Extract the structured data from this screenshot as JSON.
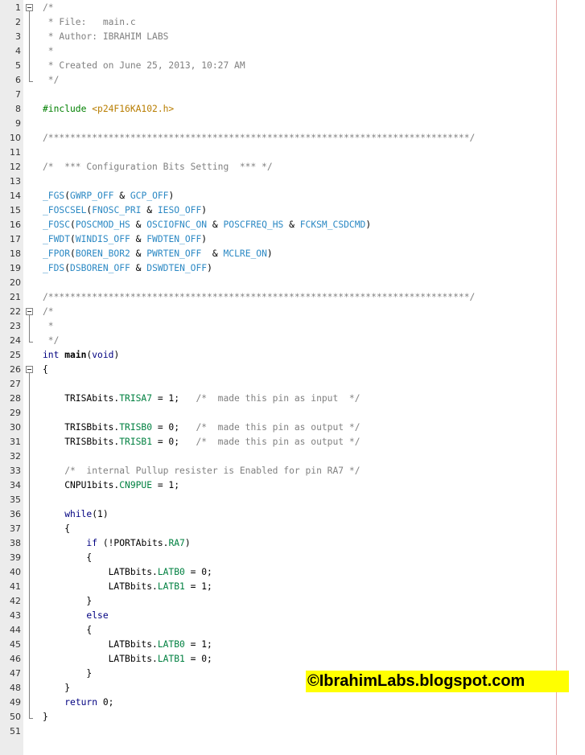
{
  "editor": {
    "lines": [
      {
        "n": "1",
        "tokens": [
          {
            "t": "/*",
            "c": "comment"
          }
        ]
      },
      {
        "n": "2",
        "tokens": [
          {
            "t": " * File:   main.c",
            "c": "comment"
          }
        ]
      },
      {
        "n": "3",
        "tokens": [
          {
            "t": " * Author: IBRAHIM LABS",
            "c": "comment"
          }
        ]
      },
      {
        "n": "4",
        "tokens": [
          {
            "t": " *",
            "c": "comment"
          }
        ]
      },
      {
        "n": "5",
        "tokens": [
          {
            "t": " * Created on June 25, 2013, 10:27 AM",
            "c": "comment"
          }
        ]
      },
      {
        "n": "6",
        "tokens": [
          {
            "t": " */",
            "c": "comment"
          }
        ]
      },
      {
        "n": "7",
        "tokens": []
      },
      {
        "n": "8",
        "tokens": [
          {
            "t": "#include ",
            "c": "pre"
          },
          {
            "t": "<p24F16KA102.h>",
            "c": "str"
          }
        ]
      },
      {
        "n": "9",
        "tokens": []
      },
      {
        "n": "10",
        "tokens": [
          {
            "t": "/*****************************************************************************/",
            "c": "comment"
          }
        ]
      },
      {
        "n": "11",
        "tokens": []
      },
      {
        "n": "12",
        "tokens": [
          {
            "t": "/*  *** Configuration Bits Setting  *** */",
            "c": "comment"
          }
        ]
      },
      {
        "n": "13",
        "tokens": []
      },
      {
        "n": "14",
        "tokens": [
          {
            "t": "_FGS",
            "c": "mac"
          },
          {
            "t": "(",
            "c": ""
          },
          {
            "t": "GWRP_OFF",
            "c": "mac"
          },
          {
            "t": " & ",
            "c": ""
          },
          {
            "t": "GCP_OFF",
            "c": "mac"
          },
          {
            "t": ")",
            "c": ""
          }
        ]
      },
      {
        "n": "15",
        "tokens": [
          {
            "t": "_FOSCSEL",
            "c": "mac"
          },
          {
            "t": "(",
            "c": ""
          },
          {
            "t": "FNOSC_PRI",
            "c": "mac"
          },
          {
            "t": " & ",
            "c": ""
          },
          {
            "t": "IESO_OFF",
            "c": "mac"
          },
          {
            "t": ")",
            "c": ""
          }
        ]
      },
      {
        "n": "16",
        "tokens": [
          {
            "t": "_FOSC",
            "c": "mac"
          },
          {
            "t": "(",
            "c": ""
          },
          {
            "t": "POSCMOD_HS",
            "c": "mac"
          },
          {
            "t": " & ",
            "c": ""
          },
          {
            "t": "OSCIOFNC_ON",
            "c": "mac"
          },
          {
            "t": " & ",
            "c": ""
          },
          {
            "t": "POSCFREQ_HS",
            "c": "mac"
          },
          {
            "t": " & ",
            "c": ""
          },
          {
            "t": "FCKSM_CSDCMD",
            "c": "mac"
          },
          {
            "t": ")",
            "c": ""
          }
        ]
      },
      {
        "n": "17",
        "tokens": [
          {
            "t": "_FWDT",
            "c": "mac"
          },
          {
            "t": "(",
            "c": ""
          },
          {
            "t": "WINDIS_OFF",
            "c": "mac"
          },
          {
            "t": " & ",
            "c": ""
          },
          {
            "t": "FWDTEN_OFF",
            "c": "mac"
          },
          {
            "t": ")",
            "c": ""
          }
        ]
      },
      {
        "n": "18",
        "tokens": [
          {
            "t": "_FPOR",
            "c": "mac"
          },
          {
            "t": "(",
            "c": ""
          },
          {
            "t": "BOREN_BOR2",
            "c": "mac"
          },
          {
            "t": " & ",
            "c": ""
          },
          {
            "t": "PWRTEN_OFF",
            "c": "mac"
          },
          {
            "t": "  & ",
            "c": ""
          },
          {
            "t": "MCLRE_ON",
            "c": "mac"
          },
          {
            "t": ")",
            "c": ""
          }
        ]
      },
      {
        "n": "19",
        "tokens": [
          {
            "t": "_FDS",
            "c": "mac"
          },
          {
            "t": "(",
            "c": ""
          },
          {
            "t": "DSBOREN_OFF",
            "c": "mac"
          },
          {
            "t": " & ",
            "c": ""
          },
          {
            "t": "DSWDTEN_OFF",
            "c": "mac"
          },
          {
            "t": ")",
            "c": ""
          }
        ]
      },
      {
        "n": "20",
        "tokens": []
      },
      {
        "n": "21",
        "tokens": [
          {
            "t": "/*****************************************************************************/",
            "c": "comment"
          }
        ]
      },
      {
        "n": "22",
        "tokens": [
          {
            "t": "/*",
            "c": "comment"
          }
        ]
      },
      {
        "n": "23",
        "tokens": [
          {
            "t": " *",
            "c": "comment"
          }
        ]
      },
      {
        "n": "24",
        "tokens": [
          {
            "t": " */",
            "c": "comment"
          }
        ]
      },
      {
        "n": "25",
        "tokens": [
          {
            "t": "int",
            "c": "kw"
          },
          {
            "t": " ",
            "c": ""
          },
          {
            "t": "main",
            "c": "bold"
          },
          {
            "t": "(",
            "c": ""
          },
          {
            "t": "void",
            "c": "kw"
          },
          {
            "t": ")",
            "c": ""
          }
        ]
      },
      {
        "n": "26",
        "tokens": [
          {
            "t": "{",
            "c": ""
          }
        ]
      },
      {
        "n": "27",
        "tokens": []
      },
      {
        "n": "28",
        "tokens": [
          {
            "t": "    TRISAbits.",
            "c": ""
          },
          {
            "t": "TRISA7",
            "c": "fld"
          },
          {
            "t": " = 1;   ",
            "c": ""
          },
          {
            "t": "/*  made this pin as input  */",
            "c": "comment"
          }
        ]
      },
      {
        "n": "29",
        "tokens": []
      },
      {
        "n": "30",
        "tokens": [
          {
            "t": "    TRISBbits.",
            "c": ""
          },
          {
            "t": "TRISB0",
            "c": "fld"
          },
          {
            "t": " = 0;   ",
            "c": ""
          },
          {
            "t": "/*  made this pin as output */",
            "c": "comment"
          }
        ]
      },
      {
        "n": "31",
        "tokens": [
          {
            "t": "    TRISBbits.",
            "c": ""
          },
          {
            "t": "TRISB1",
            "c": "fld"
          },
          {
            "t": " = 0;   ",
            "c": ""
          },
          {
            "t": "/*  made this pin as output */",
            "c": "comment"
          }
        ]
      },
      {
        "n": "32",
        "tokens": []
      },
      {
        "n": "33",
        "tokens": [
          {
            "t": "    ",
            "c": ""
          },
          {
            "t": "/*  internal Pullup resister is Enabled for pin RA7 */",
            "c": "comment"
          }
        ]
      },
      {
        "n": "34",
        "tokens": [
          {
            "t": "    CNPU1bits.",
            "c": ""
          },
          {
            "t": "CN9PUE",
            "c": "fld"
          },
          {
            "t": " = 1;",
            "c": ""
          }
        ]
      },
      {
        "n": "35",
        "tokens": []
      },
      {
        "n": "36",
        "tokens": [
          {
            "t": "    ",
            "c": ""
          },
          {
            "t": "while",
            "c": "kw"
          },
          {
            "t": "(1)",
            "c": ""
          }
        ]
      },
      {
        "n": "37",
        "tokens": [
          {
            "t": "    {",
            "c": ""
          }
        ]
      },
      {
        "n": "38",
        "tokens": [
          {
            "t": "        ",
            "c": ""
          },
          {
            "t": "if",
            "c": "kw"
          },
          {
            "t": " (!PORTAbits.",
            "c": ""
          },
          {
            "t": "RA7",
            "c": "fld"
          },
          {
            "t": ")",
            "c": ""
          }
        ]
      },
      {
        "n": "39",
        "tokens": [
          {
            "t": "        {",
            "c": ""
          }
        ]
      },
      {
        "n": "40",
        "tokens": [
          {
            "t": "            LATBbits.",
            "c": ""
          },
          {
            "t": "LATB0",
            "c": "fld"
          },
          {
            "t": " = 0;",
            "c": ""
          }
        ]
      },
      {
        "n": "41",
        "tokens": [
          {
            "t": "            LATBbits.",
            "c": ""
          },
          {
            "t": "LATB1",
            "c": "fld"
          },
          {
            "t": " = 1;",
            "c": ""
          }
        ]
      },
      {
        "n": "42",
        "tokens": [
          {
            "t": "        }",
            "c": ""
          }
        ]
      },
      {
        "n": "43",
        "tokens": [
          {
            "t": "        ",
            "c": ""
          },
          {
            "t": "else",
            "c": "kw"
          }
        ]
      },
      {
        "n": "44",
        "tokens": [
          {
            "t": "        {",
            "c": ""
          }
        ]
      },
      {
        "n": "45",
        "tokens": [
          {
            "t": "            LATBbits.",
            "c": ""
          },
          {
            "t": "LATB0",
            "c": "fld"
          },
          {
            "t": " = 1;",
            "c": ""
          }
        ]
      },
      {
        "n": "46",
        "tokens": [
          {
            "t": "            LATBbits.",
            "c": ""
          },
          {
            "t": "LATB1",
            "c": "fld"
          },
          {
            "t": " = 0;",
            "c": ""
          }
        ]
      },
      {
        "n": "47",
        "tokens": [
          {
            "t": "        }",
            "c": ""
          }
        ]
      },
      {
        "n": "48",
        "tokens": [
          {
            "t": "    }",
            "c": ""
          }
        ]
      },
      {
        "n": "49",
        "tokens": [
          {
            "t": "    ",
            "c": ""
          },
          {
            "t": "return",
            "c": "kw"
          },
          {
            "t": " 0;",
            "c": ""
          }
        ]
      },
      {
        "n": "50",
        "tokens": [
          {
            "t": "}",
            "c": ""
          }
        ]
      },
      {
        "n": "51",
        "tokens": []
      }
    ],
    "folds": [
      {
        "start": "1",
        "end": "6"
      },
      {
        "start": "22",
        "end": "24"
      },
      {
        "start": "26",
        "end": "50"
      }
    ]
  },
  "colors": {
    "comment": "#808080",
    "preprocessor": "#008000",
    "include_path": "#b87d00",
    "macro": "#2c89c4",
    "keyword": "#000080",
    "field": "#008040",
    "watermark_bg": "#ffff00"
  },
  "icons": {
    "fold": "fold-minus-icon"
  },
  "watermark": {
    "text": "©IbrahimLabs.blogspot.com"
  }
}
